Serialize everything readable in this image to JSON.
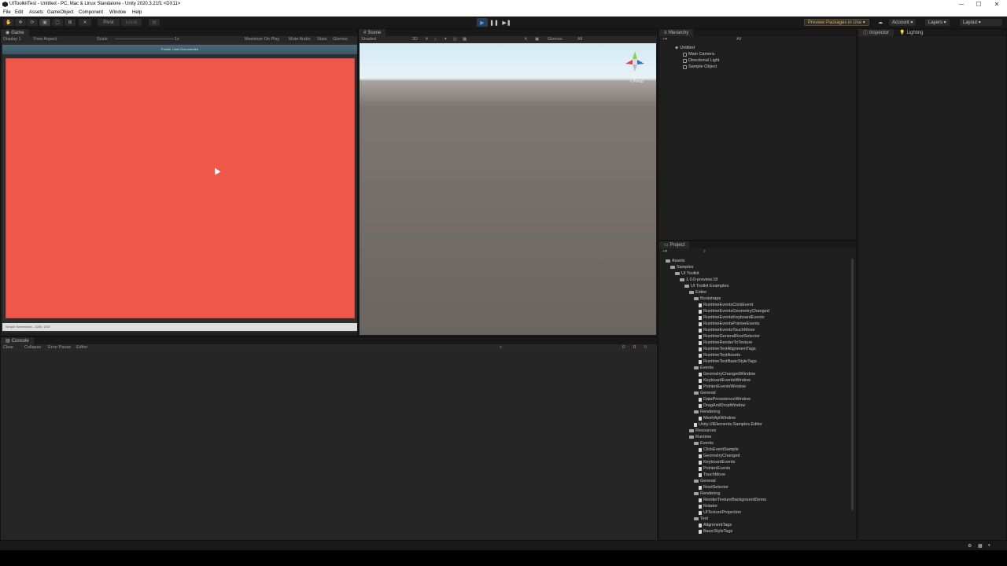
{
  "window": {
    "title": "UIToolkitTest - Untitled - PC, Mac & Linux Standalone - Unity 2020.3.21f1 <DX11>",
    "controls": {
      "minimize": "─",
      "maximize": "☐",
      "close": "✕"
    }
  },
  "menu": [
    "File",
    "Edit",
    "Assets",
    "GameObject",
    "Component",
    "Window",
    "Help"
  ],
  "toolbar": {
    "pivot": "Pivot",
    "local": "Local",
    "preview_packages": "Preview Packages in Use ▾",
    "account": "Account ▾",
    "layers": "Layers ▾",
    "layout": "Layout ▾"
  },
  "game": {
    "tab": "Game",
    "display": "Display 1",
    "aspect": "Free Aspect",
    "scale_label": "Scale",
    "scale_value": "1x",
    "maximize": "Maximize On Play",
    "mute": "Mute Audio",
    "stats": "Stats",
    "gizmos": "Gizmos",
    "header_text": "Pointer Lines Documented",
    "footer_text": "Simple Screenshot - 1280, 1037",
    "canvas_color": "#f0574b"
  },
  "scene": {
    "tab": "Scene",
    "shading": "Shaded",
    "mode_2d": "2D",
    "gizmos": "Gizmos",
    "search": "All",
    "persp": "< Persp"
  },
  "hierarchy": {
    "tab": "Hierarchy",
    "search": "All",
    "root": "Untitled",
    "items": [
      "Main Camera",
      "Directional Light",
      "Sample Object"
    ]
  },
  "inspector": {
    "tab": "Inspector",
    "lighting_tab": "Lighting"
  },
  "console": {
    "tab": "Console",
    "clear": "Clear",
    "collapse": "Collapse",
    "error_pause": "Error Pause",
    "editor": "Editor",
    "counts": [
      "0",
      "0",
      "0"
    ]
  },
  "project": {
    "tab": "Project",
    "tree": [
      {
        "label": "Assets",
        "depth": 0,
        "kind": "folder"
      },
      {
        "label": "Samples",
        "depth": 1,
        "kind": "folder"
      },
      {
        "label": "UI Toolkit",
        "depth": 2,
        "kind": "folder"
      },
      {
        "label": "1.0.0-preview.18",
        "depth": 3,
        "kind": "folder"
      },
      {
        "label": "UI Toolkit Examples",
        "depth": 4,
        "kind": "folder"
      },
      {
        "label": "Editor",
        "depth": 5,
        "kind": "folder"
      },
      {
        "label": "Bootstraps",
        "depth": 6,
        "kind": "folder"
      },
      {
        "label": "RuntimeEventsClickEvent",
        "depth": 7,
        "kind": "script"
      },
      {
        "label": "RuntimeEventsGeometryChanged",
        "depth": 7,
        "kind": "script"
      },
      {
        "label": "RuntimeEventsKeyboardEvents",
        "depth": 7,
        "kind": "script"
      },
      {
        "label": "RuntimeEventsPointerEvents",
        "depth": 7,
        "kind": "script"
      },
      {
        "label": "RuntimeEventsTouchMove",
        "depth": 7,
        "kind": "script"
      },
      {
        "label": "RuntimeGeneralRootSelector",
        "depth": 7,
        "kind": "script"
      },
      {
        "label": "RuntimeRenderToTexture",
        "depth": 7,
        "kind": "script"
      },
      {
        "label": "RuntimeTextAlignmentTags",
        "depth": 7,
        "kind": "script"
      },
      {
        "label": "RuntimeTextAssets",
        "depth": 7,
        "kind": "script"
      },
      {
        "label": "RuntimeTextBasicStyleTags",
        "depth": 7,
        "kind": "script"
      },
      {
        "label": "Events",
        "depth": 6,
        "kind": "folder"
      },
      {
        "label": "GeometryChangedWindow",
        "depth": 7,
        "kind": "script"
      },
      {
        "label": "KeyboardEventsWindow",
        "depth": 7,
        "kind": "script"
      },
      {
        "label": "PointerEventsWindow",
        "depth": 7,
        "kind": "script"
      },
      {
        "label": "General",
        "depth": 6,
        "kind": "folder"
      },
      {
        "label": "DataPersistenceWindow",
        "depth": 7,
        "kind": "script"
      },
      {
        "label": "DragAndDropWindow",
        "depth": 7,
        "kind": "script"
      },
      {
        "label": "Rendering",
        "depth": 6,
        "kind": "folder"
      },
      {
        "label": "MeshApiWindow",
        "depth": 7,
        "kind": "script"
      },
      {
        "label": "Unity.UIElements.Samples.Editor",
        "depth": 6,
        "kind": "script"
      },
      {
        "label": "Resources",
        "depth": 5,
        "kind": "folder"
      },
      {
        "label": "Runtime",
        "depth": 5,
        "kind": "folder"
      },
      {
        "label": "Events",
        "depth": 6,
        "kind": "folder"
      },
      {
        "label": "ClickEventSample",
        "depth": 7,
        "kind": "script"
      },
      {
        "label": "GeometryChanged",
        "depth": 7,
        "kind": "script"
      },
      {
        "label": "KeyboardEvents",
        "depth": 7,
        "kind": "script"
      },
      {
        "label": "PointerEvents",
        "depth": 7,
        "kind": "script"
      },
      {
        "label": "TouchMove",
        "depth": 7,
        "kind": "script"
      },
      {
        "label": "General",
        "depth": 6,
        "kind": "folder"
      },
      {
        "label": "RootSelector",
        "depth": 7,
        "kind": "script"
      },
      {
        "label": "Rendering",
        "depth": 6,
        "kind": "folder"
      },
      {
        "label": "RenderTextureBackgroundDemo",
        "depth": 7,
        "kind": "script"
      },
      {
        "label": "Rotator",
        "depth": 7,
        "kind": "script"
      },
      {
        "label": "UITextureProjection",
        "depth": 7,
        "kind": "script"
      },
      {
        "label": "Text",
        "depth": 6,
        "kind": "folder"
      },
      {
        "label": "AlignmentTags",
        "depth": 7,
        "kind": "script"
      },
      {
        "label": "BasicStyleTags",
        "depth": 7,
        "kind": "script"
      }
    ]
  },
  "colors": {
    "accent": "#4c9bff",
    "panel_bg": "#1f1f1f",
    "game_red": "#f0574b"
  }
}
